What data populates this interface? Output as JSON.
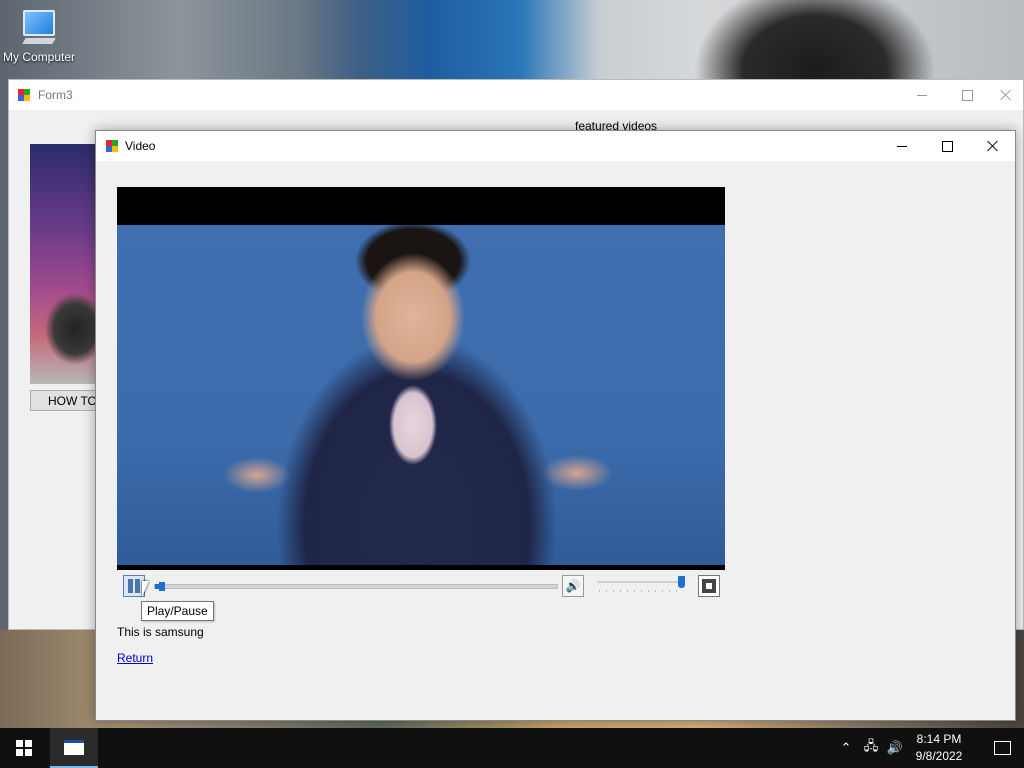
{
  "desktop": {
    "icons": [
      {
        "label": "My Computer"
      }
    ]
  },
  "form3": {
    "title": "Form3",
    "heading": "featured videos",
    "button_label": "HOW TO"
  },
  "video_window": {
    "title": "Video",
    "tooltip": "Play/Pause",
    "caption": "This is samsung",
    "return_link": "Return",
    "playback_progress": 0.01,
    "volume_level": 1.0
  },
  "taskbar": {
    "time": "8:14 PM",
    "date": "9/8/2022",
    "tray_icons": [
      "chevron-up-icon",
      "network-icon",
      "volume-icon"
    ]
  }
}
